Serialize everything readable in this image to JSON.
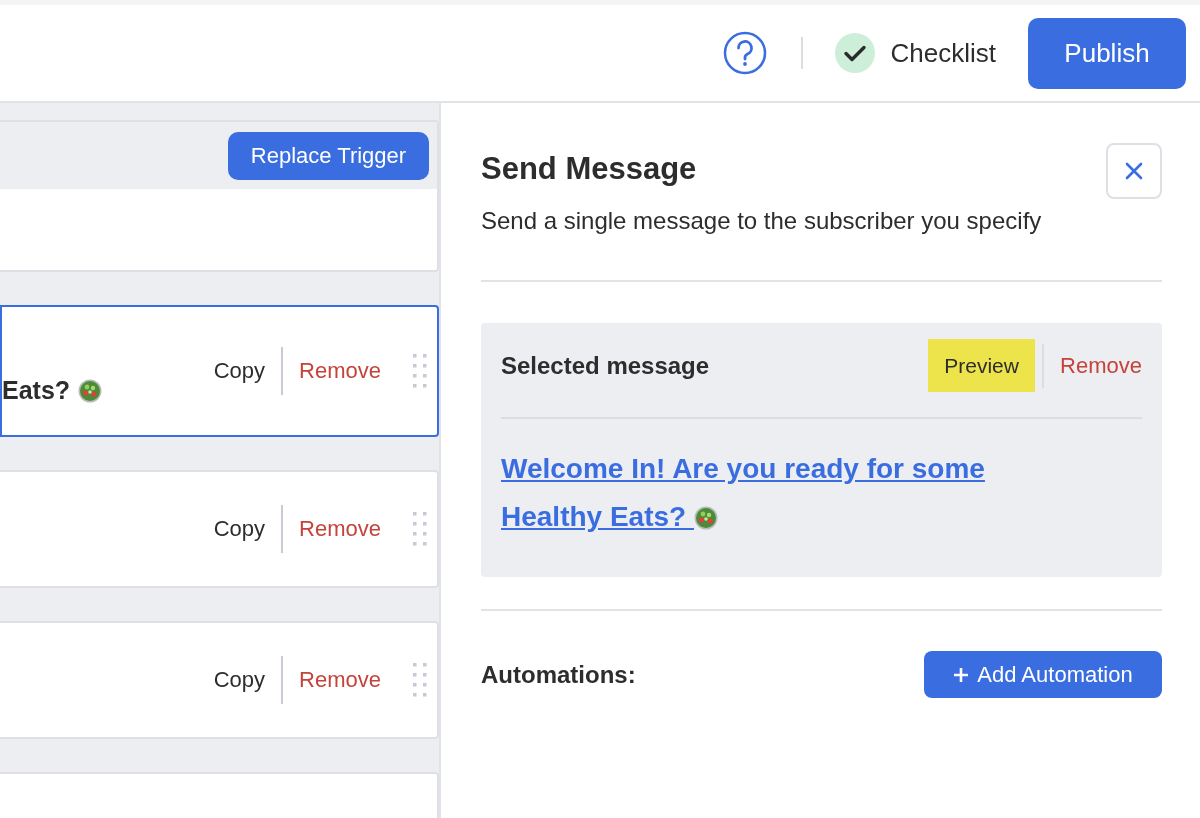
{
  "top_bar": {
    "checklist_label": "Checklist",
    "checklist_done": true,
    "publish_label": "Publish"
  },
  "trigger_card": {
    "button": "Replace Trigger"
  },
  "steps": [
    {
      "title": "Eats?",
      "salad_icon": true,
      "selected": true,
      "copy": "Copy",
      "remove": "Remove"
    },
    {
      "selected": false,
      "copy": "Copy",
      "remove": "Remove"
    },
    {
      "selected": false,
      "copy": "Copy",
      "remove": "Remove"
    },
    {
      "selected": false
    }
  ],
  "panel": {
    "title": "Send Message",
    "subtitle": "Send a single message to the subscriber you specify",
    "selected_message": {
      "heading": "Selected message",
      "preview": "Preview",
      "remove": "Remove",
      "link": "Welcome In! Are you ready for some Healthy Eats?",
      "salad_icon": true
    },
    "automations_label": "Automations:",
    "add_automation": "Add Automation"
  }
}
